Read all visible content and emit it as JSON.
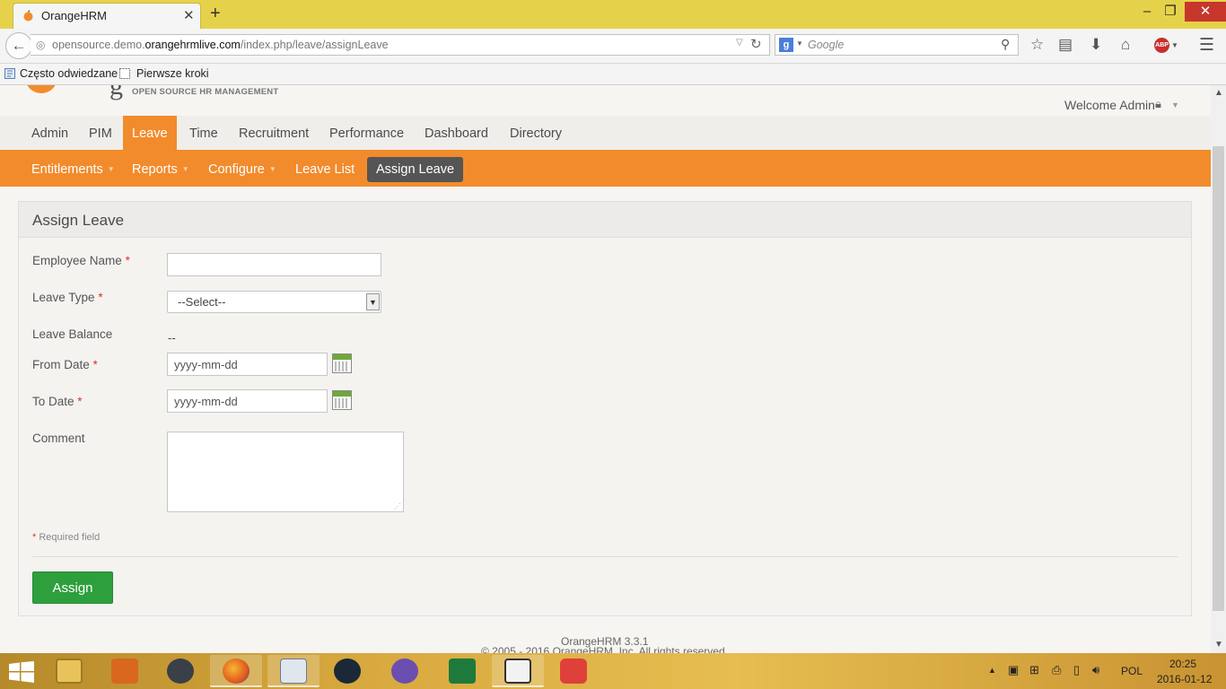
{
  "browser": {
    "tab_title": "OrangeHRM",
    "url_host_prefix": "opensource.demo.",
    "url_host_main": "orangehrmlive.com",
    "url_path": "/index.php/leave/assignLeave",
    "search_placeholder": "Google",
    "bookmarks": [
      "Często odwiedzane",
      "Pierwsze kroki"
    ],
    "abp_label": "ABP"
  },
  "header": {
    "logo_letter": "g",
    "logo_tagline": "OPEN SOURCE HR MANAGEMENT",
    "welcome": "Welcome Admin"
  },
  "main_menu": [
    "Admin",
    "PIM",
    "Leave",
    "Time",
    "Recruitment",
    "Performance",
    "Dashboard",
    "Directory"
  ],
  "sub_menu": [
    "Entitlements",
    "Reports",
    "Configure",
    "Leave List",
    "Assign Leave"
  ],
  "form": {
    "title": "Assign Leave",
    "employee_label": "Employee Name",
    "leave_type_label": "Leave Type",
    "leave_type_value": "--Select--",
    "leave_balance_label": "Leave Balance",
    "leave_balance_value": "--",
    "from_date_label": "From Date",
    "from_date_placeholder": "yyyy-mm-dd",
    "to_date_label": "To Date",
    "to_date_placeholder": "yyyy-mm-dd",
    "comment_label": "Comment",
    "required_star": "*",
    "required_note": "Required field",
    "assign_button": "Assign"
  },
  "footer": {
    "version": "OrangeHRM 3.3.1",
    "copyright": "© 2005 - 2016 OrangeHRM, Inc. All rights reserved."
  },
  "taskbar": {
    "language": "POL",
    "time": "20:25",
    "date": "2016-01-12"
  },
  "colors": {
    "brand_orange": "#f28b2c",
    "assign_green": "#2e9f3d",
    "required_red": "#e2322a"
  }
}
